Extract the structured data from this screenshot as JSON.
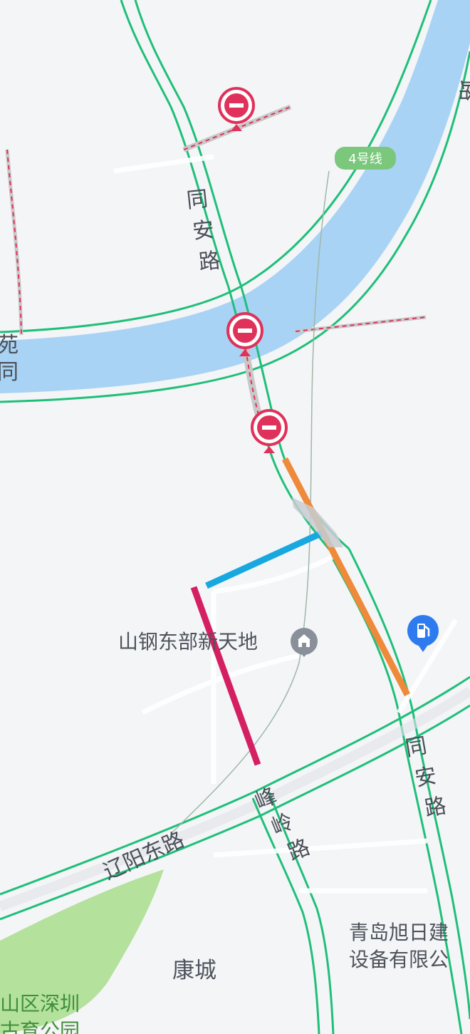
{
  "map": {
    "roads": {
      "tongan_north": [
        "同",
        "安",
        "路"
      ],
      "tongan_south": [
        "同",
        "安",
        "路"
      ],
      "liaoyang": "辽阳东路",
      "fengling": [
        "峰",
        "岭",
        "路"
      ],
      "edge_top_right": "路",
      "edge_left": [
        "苑",
        "同"
      ]
    },
    "metro_line": "4号线",
    "pois": {
      "landmark": "山钢东部新天地",
      "company_line1": "青岛旭日建",
      "company_line2": "设备有限公",
      "area": "康城",
      "park_line1": "山区深圳",
      "park_line2": "古育公园"
    },
    "icons": {
      "closure": "road-closed-icon",
      "landmark": "mall-icon",
      "gas": "gas-station-icon"
    },
    "colors": {
      "water": "#a9d3f5",
      "road_edge": "#1fbf7a",
      "closure": "#e0315a",
      "overlay_orange": "#ef8a3a",
      "overlay_blue": "#18a8e0",
      "overlay_magenta": "#d41f62",
      "park": "#a8dd8c",
      "gas": "#2e7bf0"
    }
  }
}
